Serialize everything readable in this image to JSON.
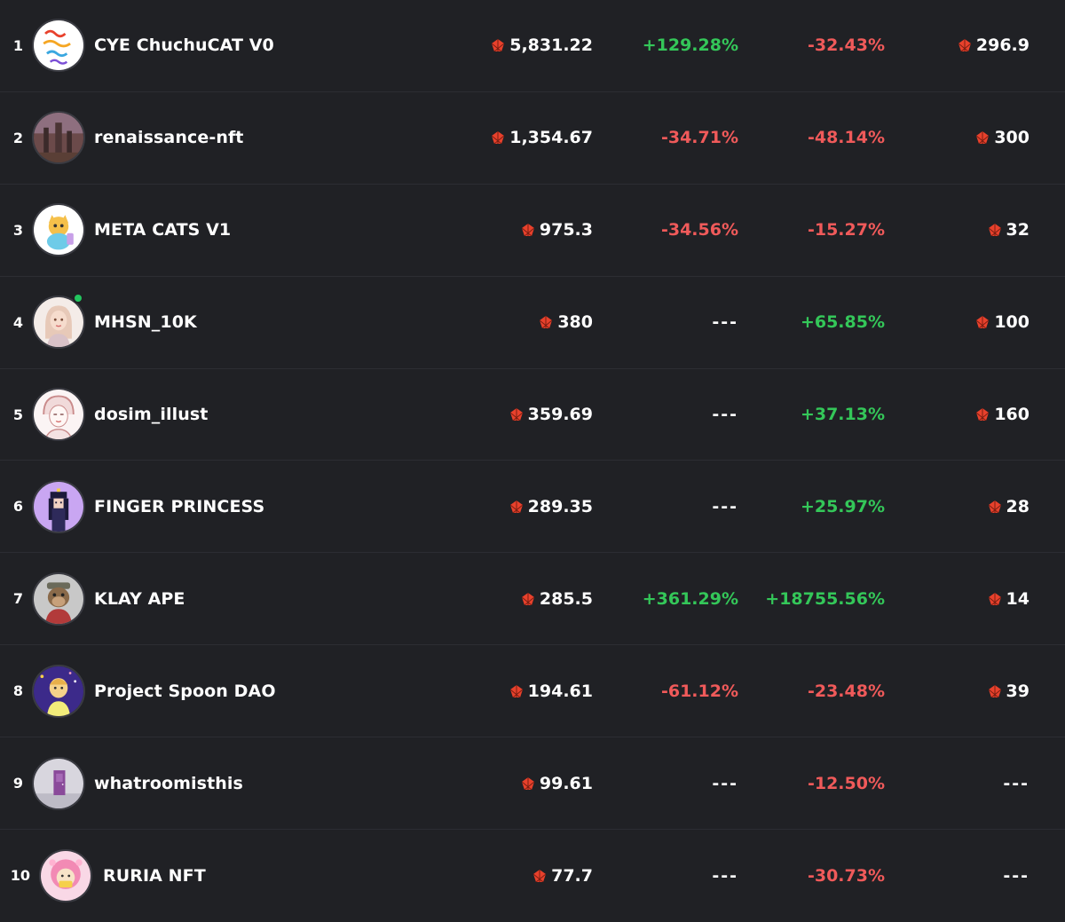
{
  "colors": {
    "background": "#202125",
    "positive": "#34c759",
    "negative": "#f05a5a",
    "token": "#e8412c"
  },
  "rows": [
    {
      "rank": "1",
      "name": "CYE ChuchuCAT V0",
      "volume": "5,831.22",
      "change1": "+129.28%",
      "change2": "-32.43%",
      "floor": "296.9",
      "avatar_icon": "close-your-eyes-text-avatar"
    },
    {
      "rank": "2",
      "name": "renaissance-nft",
      "volume": "1,354.67",
      "change1": "-34.71%",
      "change2": "-48.14%",
      "floor": "300",
      "avatar_icon": "renaissance-painting-avatar"
    },
    {
      "rank": "3",
      "name": "META CATS V1",
      "volume": "975.3",
      "change1": "-34.56%",
      "change2": "-15.27%",
      "floor": "32",
      "avatar_icon": "cartoon-cat-avatar"
    },
    {
      "rank": "4",
      "name": "MHSN_10K",
      "volume": "380",
      "change1": "---",
      "change2": "+65.85%",
      "floor": "100",
      "avatar_icon": "illustrated-woman-avatar"
    },
    {
      "rank": "5",
      "name": "dosim_illust",
      "volume": "359.69",
      "change1": "---",
      "change2": "+37.13%",
      "floor": "160",
      "avatar_icon": "sketch-portrait-avatar"
    },
    {
      "rank": "6",
      "name": "FINGER PRINCESS",
      "volume": "289.35",
      "change1": "---",
      "change2": "+25.97%",
      "floor": "28",
      "avatar_icon": "pixel-princess-avatar"
    },
    {
      "rank": "7",
      "name": "KLAY APE",
      "volume": "285.5",
      "change1": "+361.29%",
      "change2": "+18755.56%",
      "floor": "14",
      "avatar_icon": "ape-avatar"
    },
    {
      "rank": "8",
      "name": "Project Spoon DAO",
      "volume": "194.61",
      "change1": "-61.12%",
      "change2": "-23.48%",
      "floor": "39",
      "avatar_icon": "spoon-character-avatar"
    },
    {
      "rank": "9",
      "name": "whatroomisthis",
      "volume": "99.61",
      "change1": "---",
      "change2": "-12.50%",
      "floor": "---",
      "avatar_icon": "room-door-avatar"
    },
    {
      "rank": "10",
      "name": "RURIA NFT",
      "volume": "77.7",
      "change1": "---",
      "change2": "-30.73%",
      "floor": "---",
      "avatar_icon": "pink-hair-girl-avatar"
    }
  ]
}
